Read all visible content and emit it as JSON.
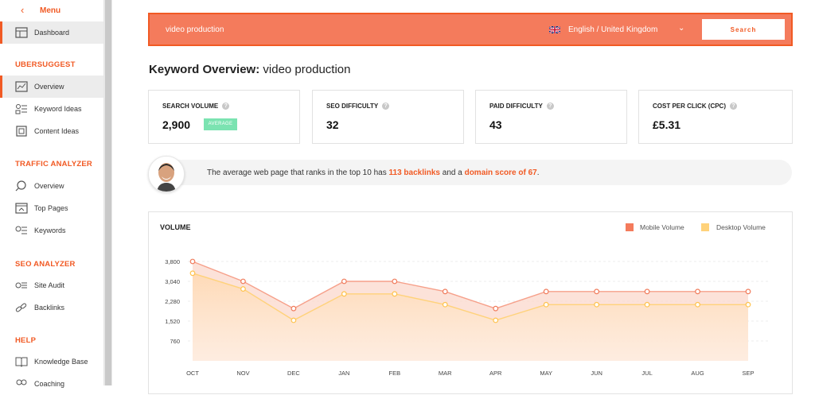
{
  "sidebar": {
    "menu_label": "Menu",
    "dashboard": "Dashboard",
    "sections": {
      "ubersuggest": "UBERSUGGEST",
      "traffic": "TRAFFIC ANALYZER",
      "seo": "SEO ANALYZER",
      "help": "HELP"
    },
    "ubersuggest_items": [
      "Overview",
      "Keyword Ideas",
      "Content Ideas"
    ],
    "traffic_items": [
      "Overview",
      "Top Pages",
      "Keywords"
    ],
    "seo_items": [
      "Site Audit",
      "Backlinks"
    ],
    "help_items": [
      "Knowledge Base",
      "Coaching"
    ]
  },
  "search": {
    "query": "video production",
    "language": "English / United Kingdom",
    "button": "Search"
  },
  "overview": {
    "title_bold": "Keyword Overview:",
    "title_keyword": "video production"
  },
  "metrics": [
    {
      "label": "SEARCH VOLUME",
      "value": "2,900",
      "badge": "AVERAGE"
    },
    {
      "label": "SEO DIFFICULTY",
      "value": "32"
    },
    {
      "label": "PAID DIFFICULTY",
      "value": "43"
    },
    {
      "label": "COST PER CLICK (CPC)",
      "value": "£5.31"
    }
  ],
  "tip": {
    "prefix": "The average web page that ranks in the top 10 has ",
    "backlinks": "113 backlinks",
    "middle": " and a ",
    "domain": "domain score of 67",
    "suffix": "."
  },
  "colors": {
    "accent": "#f15a24",
    "mobile": "#f15a24",
    "desktop": "#ffd27a",
    "badge": "#7be3b1"
  },
  "chart_data": {
    "type": "area",
    "title": "VOLUME",
    "categories": [
      "OCT",
      "NOV",
      "DEC",
      "JAN",
      "FEB",
      "MAR",
      "APR",
      "MAY",
      "JUN",
      "JUL",
      "AUG",
      "SEP"
    ],
    "y_ticks": [
      "3,800",
      "3,040",
      "2,280",
      "1,520",
      "760"
    ],
    "ylim": [
      0,
      3800
    ],
    "grid": true,
    "legend_position": "top-right",
    "series": [
      {
        "name": "Mobile Volume",
        "values": [
          3800,
          3040,
          2000,
          3040,
          3040,
          2650,
          2000,
          2650,
          2650,
          2650,
          2650,
          2650
        ]
      },
      {
        "name": "Desktop Volume",
        "values": [
          3350,
          2750,
          1550,
          2560,
          2560,
          2150,
          1550,
          2150,
          2150,
          2150,
          2150,
          2150
        ]
      }
    ]
  }
}
